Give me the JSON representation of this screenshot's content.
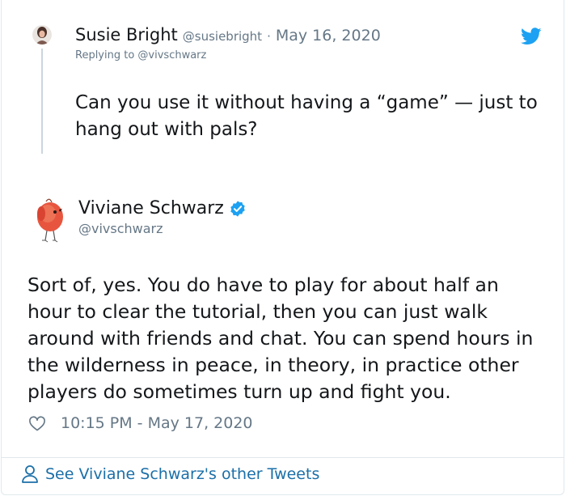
{
  "reply_tweet": {
    "name": "Susie Bright",
    "handle": "@susiebright",
    "separator": "·",
    "date": "May 16, 2020",
    "replying_to": "Replying to @vivschwarz",
    "text": "Can you use it without having a “game” — just to hang out with pals?"
  },
  "main_tweet": {
    "name": "Viviane Schwarz",
    "handle": "@vivschwarz",
    "text": "Sort of, yes. You do have to play for about half an hour to clear the tutorial, then you can just walk around with friends and chat. You can spend hours in the wilderness in peace, in theory, in practice other players do sometimes turn up and fight you.",
    "timestamp": "10:15 PM - May 17, 2020"
  },
  "footer": {
    "see_more_label": "See Viviane Schwarz's other Tweets"
  },
  "icons": {
    "brand": "twitter-bird-icon",
    "verified": "verified-badge-icon",
    "like": "heart-icon",
    "profile": "person-icon"
  },
  "colors": {
    "brand_blue": "#1da1f2",
    "link_blue": "#1b6fa8",
    "secondary_text": "#657786",
    "primary_text": "#14171a",
    "border": "#e1e8ed"
  }
}
